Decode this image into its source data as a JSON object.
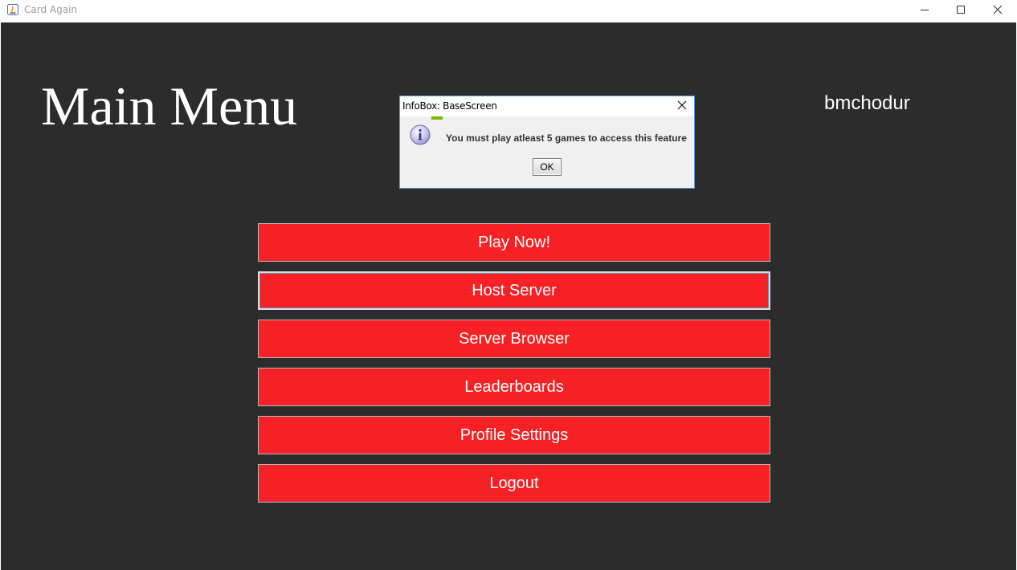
{
  "window": {
    "title": "Card Again",
    "icon": "java-app-icon",
    "controls": [
      "minimize-icon",
      "maximize-icon",
      "close-icon"
    ]
  },
  "screen": {
    "title": "Main Menu",
    "username": "bmchodur"
  },
  "menu": {
    "items": [
      {
        "label": "Play Now!"
      },
      {
        "label": "Host Server"
      },
      {
        "label": "Server Browser"
      },
      {
        "label": "Leaderboards"
      },
      {
        "label": "Profile Settings"
      },
      {
        "label": "Logout"
      }
    ],
    "focused": "Host Server"
  },
  "dialog": {
    "title": "InfoBox: BaseScreen",
    "icon": "info-icon",
    "message": "You must play atleast 5 games to access this feature",
    "ok_label": "OK"
  },
  "colors": {
    "background": "#2c2c2c",
    "button": "#f52124",
    "text": "#ffffff"
  }
}
